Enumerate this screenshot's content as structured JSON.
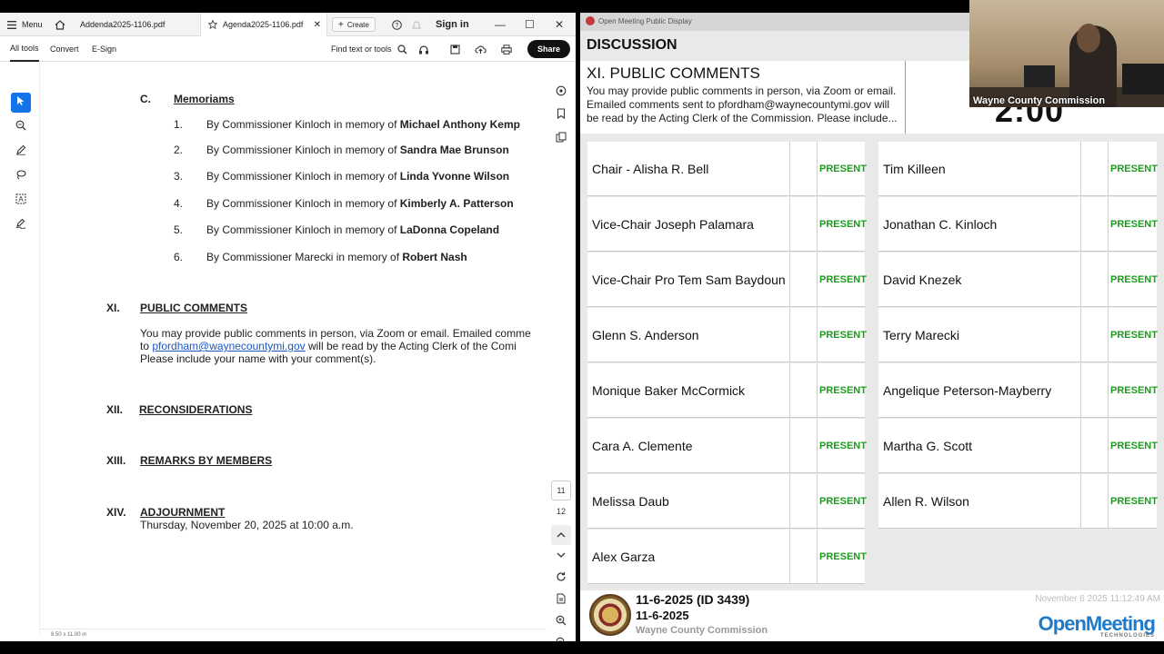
{
  "pdf": {
    "menu_label": "Menu",
    "tabs": [
      {
        "label": "Addenda2025-1106.pdf"
      },
      {
        "label": "Agenda2025-1106.pdf"
      }
    ],
    "create_label": "Create",
    "sign_in_label": "Sign in",
    "toolbar": {
      "all_tools": "All tools",
      "convert": "Convert",
      "esign": "E-Sign",
      "find": "Find text or tools",
      "share": "Share"
    },
    "doc": {
      "section_c_letter": "C.",
      "section_c_title": "Memoriams",
      "memoriams": [
        {
          "num": "1.",
          "prefix": "By Commissioner Kinloch in memory of",
          "name": "Michael Anthony Kemp"
        },
        {
          "num": "2.",
          "prefix": "By Commissioner Kinloch in memory of",
          "name": "Sandra Mae Brunson"
        },
        {
          "num": "3.",
          "prefix": "By Commissioner Kinloch in memory of",
          "name": "Linda Yvonne Wilson"
        },
        {
          "num": "4.",
          "prefix": "By Commissioner Kinloch in memory of",
          "name": "Kimberly A. Patterson"
        },
        {
          "num": "5.",
          "prefix": "By Commissioner Kinloch in memory of",
          "name": "LaDonna Copeland"
        },
        {
          "num": "6.",
          "prefix": "By Commissioner Marecki in memory of",
          "name": "Robert Nash"
        }
      ],
      "xi_num": "XI.",
      "xi_title": "PUBLIC COMMENTS",
      "xi_line1": "You may provide public comments in person, via Zoom or email. Emailed comme",
      "xi_line2_pre": "to",
      "xi_email": "pfordham@waynecountymi.gov",
      "xi_line2_post": "will be read by the Acting Clerk of the Comi",
      "xi_line3": "Please include your name with your comment(s).",
      "xii_num": "XII.",
      "xii_title": "RECONSIDERATIONS",
      "xiii_num": "XIII.",
      "xiii_title": "REMARKS BY MEMBERS",
      "xiv_num": "XIV.",
      "xiv_title": "ADJOURNMENT",
      "xiv_line": "Thursday, November 20, 2025 at 10:00 a.m."
    },
    "page_numbers": [
      "11",
      "12"
    ],
    "page_size": "8.50 x 11.00 in"
  },
  "om": {
    "topbar": "Open Meeting Public Display",
    "section": "DISCUSSION",
    "item_title": "XI. PUBLIC COMMENTS",
    "item_desc": "You may provide public comments in person, via Zoom or email. Emailed comments sent to pfordham@waynecountymi.gov will be read by the Acting Clerk of the Commission. Please include...",
    "timer": "2:00",
    "roll_left": [
      {
        "name": "Chair - Alisha R. Bell",
        "status": "PRESENT"
      },
      {
        "name": "Vice-Chair Joseph Palamara",
        "status": "PRESENT"
      },
      {
        "name": "Vice-Chair Pro Tem Sam Baydoun",
        "status": "PRESENT"
      },
      {
        "name": "Glenn S. Anderson",
        "status": "PRESENT"
      },
      {
        "name": "Monique Baker McCormick",
        "status": "PRESENT"
      },
      {
        "name": "Cara A. Clemente",
        "status": "PRESENT"
      },
      {
        "name": "Melissa Daub",
        "status": "PRESENT"
      },
      {
        "name": "Alex Garza",
        "status": "PRESENT"
      }
    ],
    "roll_right": [
      {
        "name": "Tim Killeen",
        "status": "PRESENT"
      },
      {
        "name": "Jonathan C. Kinloch",
        "status": "PRESENT"
      },
      {
        "name": "David Knezek",
        "status": "PRESENT"
      },
      {
        "name": "Terry Marecki",
        "status": "PRESENT"
      },
      {
        "name": "Angelique Peterson-Mayberry",
        "status": "PRESENT"
      },
      {
        "name": "Martha G. Scott",
        "status": "PRESENT"
      },
      {
        "name": "Allen R.  Wilson",
        "status": "PRESENT"
      }
    ],
    "footer": {
      "meeting_id": "11-6-2025 (ID 3439)",
      "meeting_date": "11-6-2025",
      "body": "Wayne County Commission",
      "clock": "November 6 2025 11:12:49 AM",
      "logo": "OpenMeeting",
      "logo_sub": "TECHNOLOGIES"
    }
  },
  "cam": {
    "label": "Wayne County Commission"
  },
  "colors": {
    "present_green": "#1f9a1f",
    "link_blue": "#1a56c4",
    "accent_blue": "#1473e6",
    "om_logo_blue": "#1e7bc9"
  }
}
